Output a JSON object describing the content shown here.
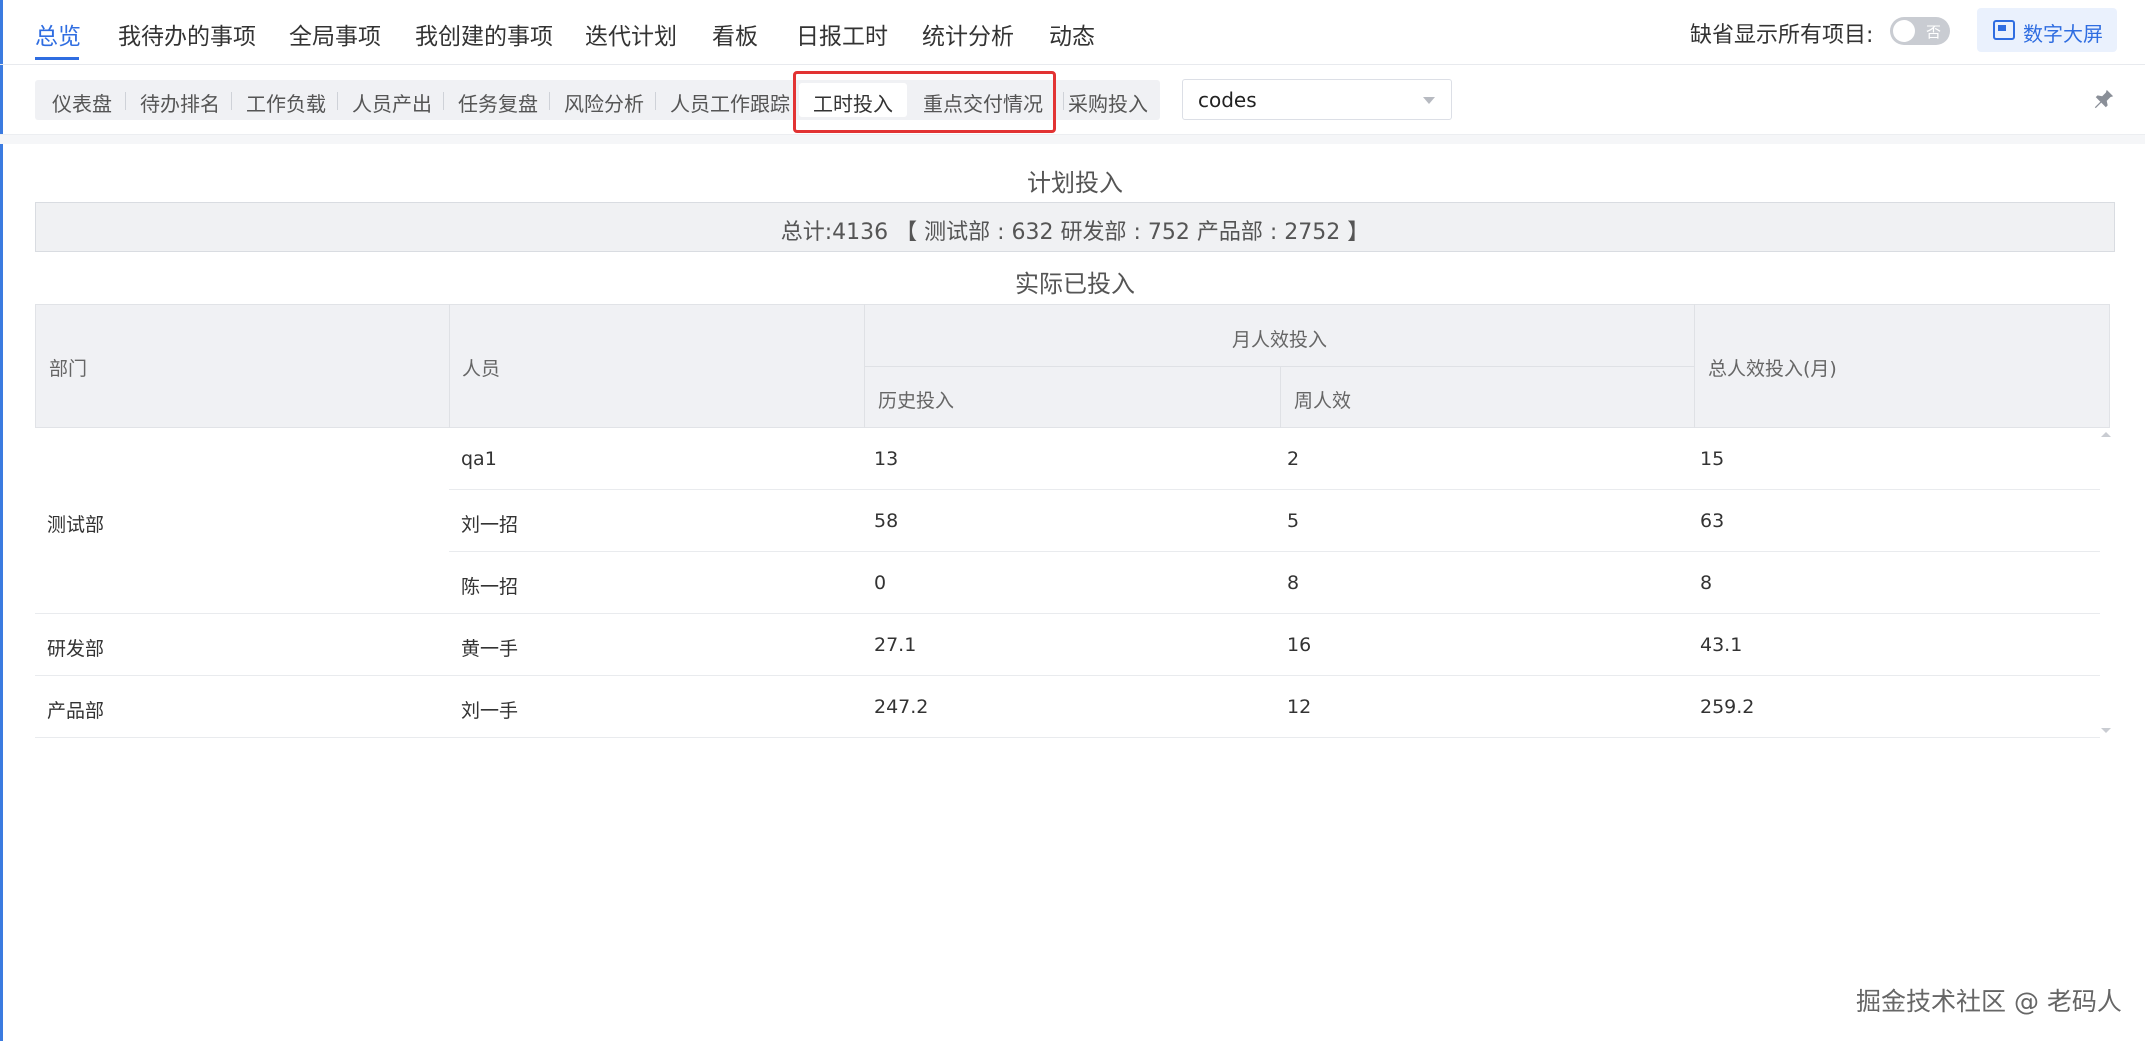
{
  "topnav": {
    "tabs": [
      "总览",
      "我待办的事项",
      "全局事项",
      "我创建的事项",
      "迭代计划",
      "看板",
      "日报工时",
      "统计分析",
      "动态"
    ],
    "active_tab": "总览",
    "toggle_label": "缺省显示所有项目:",
    "toggle_state_text": "否",
    "big_screen_label": "数字大屏"
  },
  "subnav": {
    "tabs": [
      "仪表盘",
      "待办排名",
      "工作负载",
      "人员产出",
      "任务复盘",
      "风险分析",
      "人员工作跟踪",
      "工时投入",
      "重点交付情况",
      "采购投入"
    ],
    "selected": "工时投入",
    "highlighted": [
      "工时投入",
      "重点交付情况"
    ]
  },
  "project_select": {
    "value": "codes"
  },
  "plan": {
    "title": "计划投入",
    "summary": "总计:4136 【 测试部 : 632  研发部 : 752  产品部 : 2752 】"
  },
  "actual": {
    "title": "实际已投入",
    "headers": {
      "dept": "部门",
      "person": "人员",
      "monthly": "月人效投入",
      "history": "历史投入",
      "weekly": "周人效",
      "total": "总人效投入(月)"
    },
    "groups": [
      {
        "dept": "测试部",
        "rows": [
          {
            "person": "qa1",
            "history": "13",
            "weekly": "2",
            "total": "15"
          },
          {
            "person": "刘一招",
            "history": "58",
            "weekly": "5",
            "total": "63"
          },
          {
            "person": "陈一招",
            "history": "0",
            "weekly": "8",
            "total": "8"
          }
        ]
      },
      {
        "dept": "研发部",
        "rows": [
          {
            "person": "黄一手",
            "history": "27.1",
            "weekly": "16",
            "total": "43.1"
          }
        ]
      },
      {
        "dept": "产品部",
        "rows": [
          {
            "person": "刘一手",
            "history": "247.2",
            "weekly": "12",
            "total": "259.2"
          }
        ]
      }
    ]
  },
  "watermark": "掘金技术社区 @ 老码人",
  "colors": {
    "accent": "#2f6de1",
    "highlight_border": "#e23333",
    "header_bg": "#f0f1f4"
  }
}
